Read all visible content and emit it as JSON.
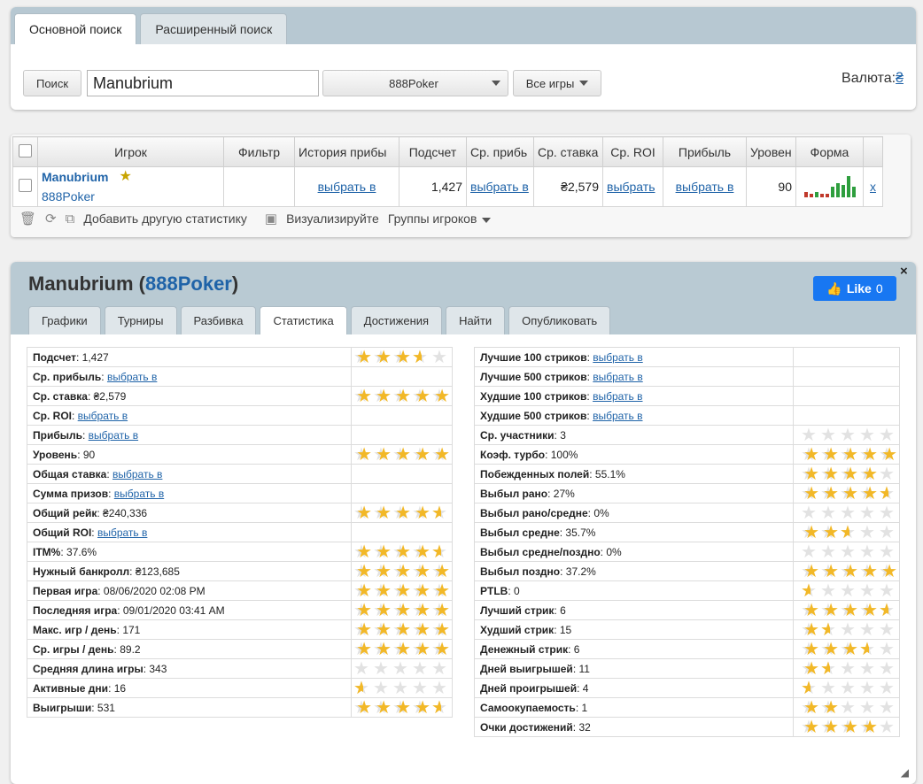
{
  "search": {
    "tabs": [
      "Основной поиск",
      "Расширенный поиск"
    ],
    "search_button": "Поиск",
    "query": "Manubrium",
    "site_select": "888Poker",
    "games_select": "Все игры",
    "currency_label": "Валюта:",
    "currency_value": "₴"
  },
  "players_table": {
    "headers": [
      "Игрок",
      "Фильтр",
      "История прибы",
      "Подсчет",
      "Ср. прибь",
      "Ср. ставка",
      "Ср. ROI",
      "Прибыль",
      "Уровен",
      "Форма"
    ],
    "row": {
      "name": "Manubrium",
      "site": "888Poker",
      "history": "выбрать в",
      "count": "1,427",
      "avg_profit": "выбрать в",
      "avg_stake": "₴2,579",
      "avg_roi": "выбрать",
      "profit": "выбрать в",
      "level": "90",
      "remove": "x",
      "form_bars": [
        {
          "value": 3,
          "color": "#c0392b"
        },
        {
          "value": 2,
          "color": "#c0392b"
        },
        {
          "value": 3,
          "color": "#2e9e3e"
        },
        {
          "value": 2,
          "color": "#c0392b"
        },
        {
          "value": 2,
          "color": "#c0392b"
        },
        {
          "value": 6,
          "color": "#2e9e3e"
        },
        {
          "value": 8,
          "color": "#2e9e3e"
        },
        {
          "value": 7,
          "color": "#2e9e3e"
        },
        {
          "value": 12,
          "color": "#2e9e3e"
        },
        {
          "value": 6,
          "color": "#2e9e3e"
        }
      ]
    },
    "toolbar": {
      "add_stats": "Добавить другую статистику",
      "visualize": "Визуализируйте",
      "groups": "Группы игроков"
    }
  },
  "detail": {
    "player_name": "Manubrium",
    "site": "888Poker",
    "like_label": "Like",
    "like_count": "0",
    "close": "×",
    "tabs": [
      "Графики",
      "Турниры",
      "Разбивка",
      "Статистика",
      "Достижения",
      "Найти",
      "Опубликовать"
    ],
    "active_tab": "Статистика",
    "left_stats": [
      {
        "label": "Подсчет",
        "value": "1,427",
        "link": false,
        "rating": 3.5
      },
      {
        "label": "Ср. прибыль",
        "value": "выбрать в",
        "link": true,
        "rating": null
      },
      {
        "label": "Ср. ставка",
        "value": "₴2,579",
        "link": false,
        "rating": 5
      },
      {
        "label": "Ср. ROI",
        "value": "выбрать в",
        "link": true,
        "rating": null
      },
      {
        "label": "Прибыль",
        "value": "выбрать в",
        "link": true,
        "rating": null
      },
      {
        "label": "Уровень",
        "value": "90",
        "link": false,
        "rating": 5
      },
      {
        "label": "Общая ставка",
        "value": "выбрать в",
        "link": true,
        "rating": null
      },
      {
        "label": "Сумма призов",
        "value": "выбрать в",
        "link": true,
        "rating": null
      },
      {
        "label": "Общий рейк",
        "value": "₴240,336",
        "link": false,
        "rating": 4.5
      },
      {
        "label": "Общий ROI",
        "value": "выбрать в",
        "link": true,
        "rating": null
      },
      {
        "label": "ITM%",
        "value": "37.6%",
        "link": false,
        "rating": 4.5
      },
      {
        "label": "Нужный банкролл",
        "value": "₴123,685",
        "link": false,
        "rating": 5
      },
      {
        "label": "Первая игра",
        "value": "08/06/2020 02:08 PM",
        "link": false,
        "rating": 5
      },
      {
        "label": "Последняя игра",
        "value": "09/01/2020 03:41 AM",
        "link": false,
        "rating": 5
      },
      {
        "label": "Макс. игр / день",
        "value": "171",
        "link": false,
        "rating": 5
      },
      {
        "label": "Ср. игры / день",
        "value": "89.2",
        "link": false,
        "rating": 5
      },
      {
        "label": "Средняя длина игры",
        "value": "343",
        "link": false,
        "rating": 0
      },
      {
        "label": "Активные дни",
        "value": "16",
        "link": false,
        "rating": 0.5
      },
      {
        "label": "Выигрыши",
        "value": "531",
        "link": false,
        "rating": 4.5
      }
    ],
    "right_stats": [
      {
        "label": "Лучшие 100 стриков",
        "value": "выбрать в",
        "link": true,
        "rating": null
      },
      {
        "label": "Лучшие 500 стриков",
        "value": "выбрать в",
        "link": true,
        "rating": null
      },
      {
        "label": "Худшие 100 стриков",
        "value": "выбрать в",
        "link": true,
        "rating": null
      },
      {
        "label": "Худшие 500 стриков",
        "value": "выбрать в",
        "link": true,
        "rating": null
      },
      {
        "label": "Ср. участники",
        "value": "3",
        "link": false,
        "rating": 0
      },
      {
        "label": "Коэф. турбо",
        "value": "100%",
        "link": false,
        "rating": 5
      },
      {
        "label": "Побежденных полей",
        "value": "55.1%",
        "link": false,
        "rating": 4
      },
      {
        "label": "Выбыл рано",
        "value": "27%",
        "link": false,
        "rating": 4.5
      },
      {
        "label": "Выбыл рано/средне",
        "value": "0%",
        "link": false,
        "rating": 0
      },
      {
        "label": "Выбыл средне",
        "value": "35.7%",
        "link": false,
        "rating": 2.5
      },
      {
        "label": "Выбыл средне/поздно",
        "value": "0%",
        "link": false,
        "rating": 0
      },
      {
        "label": "Выбыл поздно",
        "value": "37.2%",
        "link": false,
        "rating": 5
      },
      {
        "label": "PTLB",
        "value": "0",
        "link": false,
        "rating": 0.5
      },
      {
        "label": "Лучший стрик",
        "value": "6",
        "link": false,
        "rating": 4.5
      },
      {
        "label": "Худший стрик",
        "value": "15",
        "link": false,
        "rating": 1.5
      },
      {
        "label": "Денежный стрик",
        "value": "6",
        "link": false,
        "rating": 3.5
      },
      {
        "label": "Дней выигрышей",
        "value": "11",
        "link": false,
        "rating": 1.5
      },
      {
        "label": "Дней проигрышей",
        "value": "4",
        "link": false,
        "rating": 0.5
      },
      {
        "label": "Самоокупаемость",
        "value": "1",
        "link": false,
        "rating": 2
      },
      {
        "label": "Очки достижений",
        "value": "32",
        "link": false,
        "rating": 4
      }
    ]
  },
  "colors": {
    "header_bg": "#b9cad3",
    "link": "#1f63a8",
    "star_fill": "#f2b827",
    "like_bg": "#1877f2"
  }
}
